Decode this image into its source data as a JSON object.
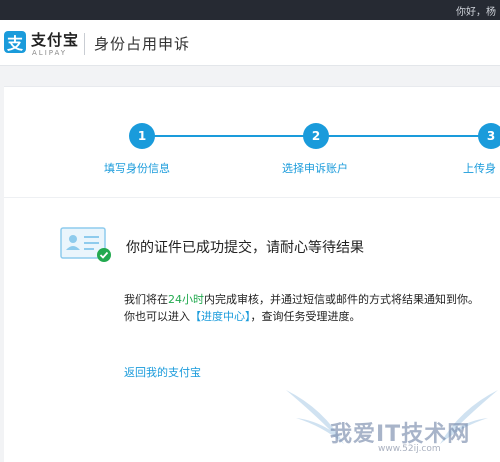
{
  "topbar": {
    "greeting": "你好，杨"
  },
  "header": {
    "logo_cn": "支付宝",
    "logo_en": "ALIPAY",
    "logo_mark": "支",
    "page_title": "身份占用申诉"
  },
  "steps": [
    {
      "number": "1",
      "label": "填写身份信息"
    },
    {
      "number": "2",
      "label": "选择申诉账户"
    },
    {
      "number": "3",
      "label": "上传身"
    }
  ],
  "result": {
    "title": "你的证件已成功提交，请耐心等待结果",
    "line1_before": "我们将在",
    "line1_highlight": "24小时",
    "line1_after": "内完成审核，并通过短信或邮件的方式将结果通知到你。",
    "line2_before": "你也可以进入",
    "line2_link": "【进度中心】",
    "line2_after": "，查询任务受理进度。",
    "back_link": "返回我的支付宝"
  },
  "watermark": {
    "text": "我爱IT技术网",
    "url": "www.52ij.com"
  },
  "colors": {
    "accent": "#1a9bdb",
    "success": "#22a94f",
    "topbar": "#262a33"
  }
}
